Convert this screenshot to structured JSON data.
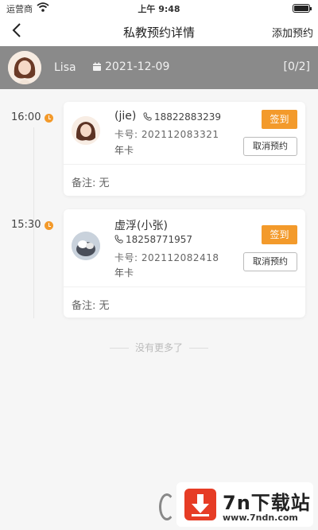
{
  "status_bar": {
    "carrier": "运营商",
    "time": "上午 9:48",
    "icons": [
      "wifi-icon",
      "battery-icon"
    ]
  },
  "nav": {
    "title": "私教预约详情",
    "add_label": "添加预约",
    "back_icon": "chevron-left-icon"
  },
  "coach": {
    "name": "Lisa",
    "date": "2021-12-09",
    "count": "[0/2]",
    "calendar_icon": "calendar-icon"
  },
  "bookings": [
    {
      "time": "16:00",
      "name": "(jie)",
      "phone": "18822883239",
      "card_no": "卡号:  202112083321",
      "card_type": "年卡",
      "sign_label": "签到",
      "cancel_label": "取消预约",
      "note": "备注: 无"
    },
    {
      "time": "15:30",
      "name": "虚浮(小张)",
      "phone": "18258771957",
      "card_no": "卡号:  202112082418",
      "card_type": "年卡",
      "sign_label": "签到",
      "cancel_label": "取消预约",
      "note": "备注: 无"
    }
  ],
  "footer": {
    "no_more": "没有更多了"
  },
  "watermark": {
    "title": "7n下载站",
    "url": "www.7ndn.com"
  },
  "colors": {
    "accent": "#f39a2b",
    "coach_bar": "#8a8a8a",
    "background": "#f6f6f6"
  }
}
